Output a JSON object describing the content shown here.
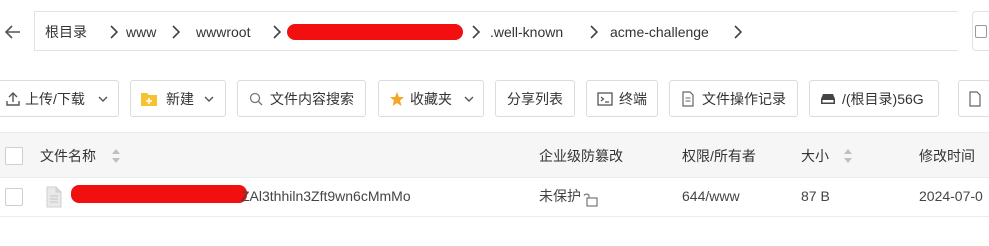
{
  "breadcrumb": {
    "items": [
      "根目录",
      "www",
      "wwwroot",
      "",
      ".well-known",
      "acme-challenge"
    ]
  },
  "toolbar": {
    "upload_download": "上传/下载",
    "new": "新建",
    "search_content": "文件内容搜索",
    "favorites": "收藏夹",
    "share_list": "分享列表",
    "terminal": "终端",
    "file_op_log": "文件操作记录",
    "disk": "/(根目录)56G"
  },
  "table": {
    "headers": {
      "name": "文件名称",
      "tamper": "企业级防篡改",
      "perm_owner": "权限/所有者",
      "size": "大小",
      "mtime": "修改时间"
    },
    "rows": [
      {
        "name_visible": "ZAl3thhiln3Zft9wn6cMmMo",
        "tamper": "未保护",
        "perm": "644/www",
        "size": "87 B",
        "mtime": "2024-07-0"
      }
    ]
  },
  "colors": {
    "redaction": "#f10f0f",
    "favorite_star": "#f5a623",
    "folder_yellow": "#f7c232"
  }
}
